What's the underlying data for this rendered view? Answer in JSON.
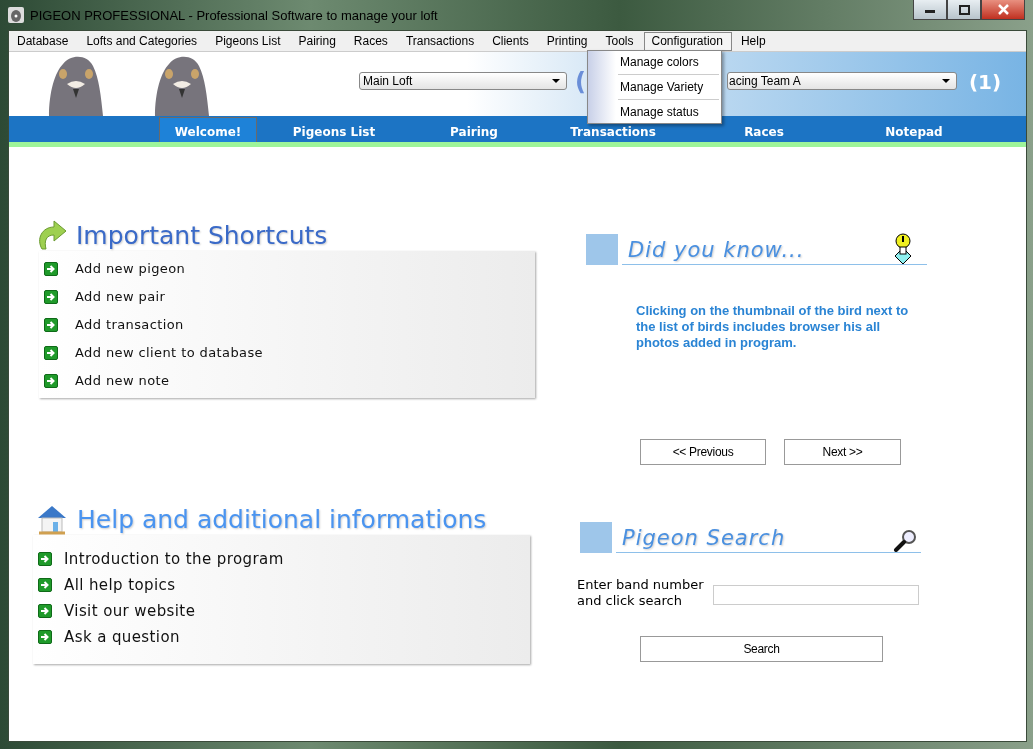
{
  "window": {
    "title": "PIGEON PROFESSIONAL - Professional Software to manage your loft"
  },
  "menu_bar": [
    {
      "label": "Database",
      "selected": false
    },
    {
      "label": "Lofts and Categories",
      "selected": false
    },
    {
      "label": "Pigeons List",
      "selected": false
    },
    {
      "label": "Pairing",
      "selected": false
    },
    {
      "label": "Races",
      "selected": false
    },
    {
      "label": "Transactions",
      "selected": false
    },
    {
      "label": "Clients",
      "selected": false
    },
    {
      "label": "Printing",
      "selected": false
    },
    {
      "label": "Tools",
      "selected": false
    },
    {
      "label": "Configuration",
      "selected": true
    },
    {
      "label": "Help",
      "selected": false
    }
  ],
  "open_menu": {
    "items": [
      "Manage colors",
      "Manage Variety",
      "Manage status"
    ]
  },
  "header": {
    "loft_select": "Main Loft",
    "paren": "(",
    "team_select": "acing Team A",
    "count": "(1)"
  },
  "tabs": [
    {
      "label": "Welcome!",
      "selected": true
    },
    {
      "label": "Pigeons List",
      "selected": false
    },
    {
      "label": "Pairing",
      "selected": false
    },
    {
      "label": "Transactions",
      "selected": false
    },
    {
      "label": "Races",
      "selected": false
    },
    {
      "label": "Notepad",
      "selected": false
    }
  ],
  "shortcuts": {
    "title": "Important Shortcuts",
    "items": [
      "Add new pigeon",
      "Add new pair",
      "Add transaction",
      "Add new client to database",
      "Add new note"
    ]
  },
  "did_you_know": {
    "title": "Did you know...",
    "text": "Clicking on the thumbnail of the bird next to the list of birds includes browser his all photos added in program.",
    "buttons": [
      "<< Previous",
      "Next >>"
    ]
  },
  "help": {
    "title": "Help and additional informations",
    "items": [
      "Introduction to the program",
      "All help topics",
      "Visit our website",
      "Ask a question"
    ]
  },
  "pigeon_search": {
    "title": "Pigeon Search",
    "label": "Enter band number and click search",
    "button": "Search"
  }
}
